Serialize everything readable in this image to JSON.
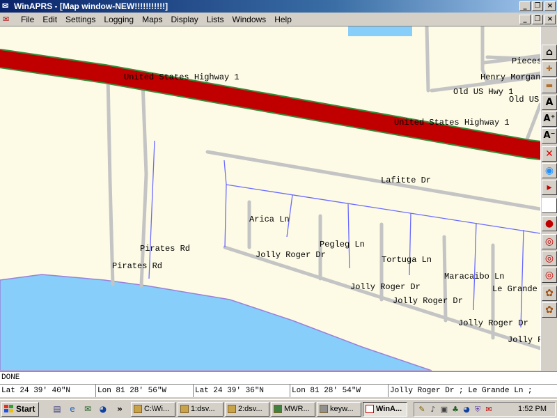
{
  "window": {
    "title": "WinAPRS - [Map window-NEW!!!!!!!!!!!]",
    "mdi_buttons": [
      "_",
      "❐",
      "×"
    ]
  },
  "menu": {
    "items": [
      "File",
      "Edit",
      "Settings",
      "Logging",
      "Maps",
      "Display",
      "Lists",
      "Windows",
      "Help"
    ]
  },
  "map": {
    "labels": {
      "us1_west": "United States Highway 1",
      "us1_east": "United States Highway 1",
      "pieces": "Pieces",
      "henry_morgan": "Henry Morgan",
      "old_us_hwy_1": "Old US Hwy 1",
      "old_us": "Old US",
      "lafitte": "Lafitte Dr",
      "arica": "Arica Ln",
      "pegleg": "Pegleg Ln",
      "tortuga": "Tortuga Ln",
      "maracaibo": "Maracaibo Ln",
      "le_grande": "Le Grande",
      "pirates_1": "Pirates Rd",
      "pirates_2": "Pirates Rd",
      "jolly_roger_1": "Jolly Roger Dr",
      "jolly_roger_2": "Jolly Roger Dr",
      "jolly_roger_3": "Jolly Roger Dr",
      "jolly_roger_4": "Jolly Roger Dr",
      "jolly_roger_5": "Jolly R"
    },
    "colors": {
      "land": "#fdfbe6",
      "water": "#87cefa",
      "highway": "#c00000",
      "road": "#bfbfbf",
      "blue_line": "#6a6aff"
    }
  },
  "toolbar": {
    "buttons": [
      {
        "name": "home-icon",
        "glyph": "⌂"
      },
      {
        "name": "zoom-in-duck-icon",
        "glyph": "🦆"
      },
      {
        "name": "zoom-out-duck-icon",
        "glyph": "🦆"
      },
      {
        "name": "font-a-icon",
        "glyph": "A"
      },
      {
        "name": "font-a-plus-icon",
        "glyph": "A⁺"
      },
      {
        "name": "font-a-minus-icon",
        "glyph": "A⁻"
      },
      {
        "name": "close-red-x-icon",
        "glyph": "✕"
      },
      {
        "name": "globe-icon",
        "glyph": "◉"
      },
      {
        "name": "play-icon",
        "glyph": "▸"
      },
      {
        "name": "blank-square-icon",
        "glyph": ""
      },
      {
        "name": "pin-icon",
        "glyph": "●"
      },
      {
        "name": "target-icon",
        "glyph": "◎"
      },
      {
        "name": "target-icon",
        "glyph": "◎"
      },
      {
        "name": "target-icon",
        "glyph": "◎"
      },
      {
        "name": "flower-icon",
        "glyph": "✿"
      },
      {
        "name": "flower-icon",
        "glyph": "✿"
      }
    ]
  },
  "status": {
    "message": "DONE",
    "lat1": "Lat  24 39' 40\"N",
    "lon1": "Lon  81 28' 56\"W",
    "lat2": "Lat  24 39' 36\"N",
    "lon2": "Lon  81 28' 54\"W",
    "road": "Jolly Roger Dr ; Le Grande Ln ;"
  },
  "taskbar": {
    "start_label": "Start",
    "tasks": [
      {
        "label": "C:\\Wi...",
        "active": false
      },
      {
        "label": "1:dsv...",
        "active": false
      },
      {
        "label": "2:dsv...",
        "active": false
      },
      {
        "label": "MWR...",
        "active": false
      },
      {
        "label": "keyw...",
        "active": false
      },
      {
        "label": "WinA...",
        "active": true
      }
    ],
    "clock": "1:52 PM"
  }
}
